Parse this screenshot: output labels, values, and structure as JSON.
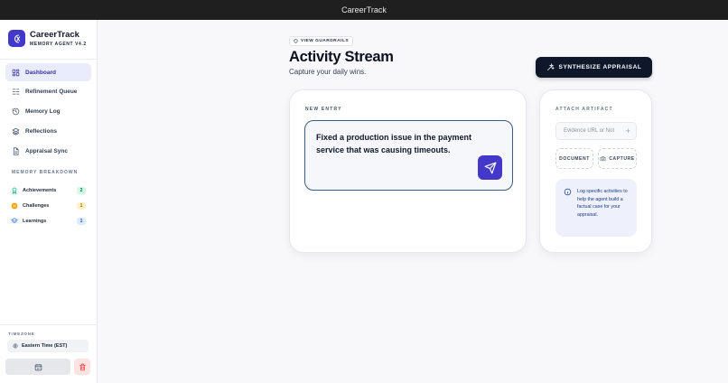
{
  "window": {
    "title": "CareerTrack"
  },
  "brand": {
    "name": "CareerTrack",
    "subtitle": "MEMORY AGENT V4.2"
  },
  "nav": [
    {
      "label": "Dashboard",
      "icon": "grid-icon",
      "active": true
    },
    {
      "label": "Refinement Queue",
      "icon": "list-filter-icon",
      "active": false
    },
    {
      "label": "Memory Log",
      "icon": "history-icon",
      "active": false
    },
    {
      "label": "Reflections",
      "icon": "layers-icon",
      "active": false
    },
    {
      "label": "Appraisal Sync",
      "icon": "document-icon",
      "active": false
    }
  ],
  "memory": {
    "title": "MEMORY BREAKDOWN",
    "items": [
      {
        "label": "Achievements",
        "count": "2",
        "icon": "award-icon",
        "color": "#10b981"
      },
      {
        "label": "Challenges",
        "count": "1",
        "icon": "alert-icon",
        "color": "#f59e0b"
      },
      {
        "label": "Learnings",
        "count": "1",
        "icon": "graduation-cap-icon",
        "color": "#3b82f6"
      }
    ]
  },
  "timezone": {
    "label": "TIMEZONE",
    "value": "Eastern Time (EST)"
  },
  "header": {
    "guardrails": "VIEW GUARDRAILS",
    "title": "Activity Stream",
    "subtitle": "Capture your daily wins.",
    "synthesize": "SYNTHESIZE APPRAISAL"
  },
  "entry": {
    "label": "NEW ENTRY",
    "text": "Fixed a production issue in the payment service that was causing timeouts."
  },
  "artifact": {
    "label": "ATTACH ARTIFACT",
    "placeholder": "Evidence URL or Not",
    "document": "DOCUMENT",
    "capture": "CAPTURE",
    "info": "Log specific activities to help the agent build a factual case for your appraisal."
  },
  "colors": {
    "accent": "#4338ca",
    "dark": "#0f172a",
    "danger": "#ef4444"
  }
}
